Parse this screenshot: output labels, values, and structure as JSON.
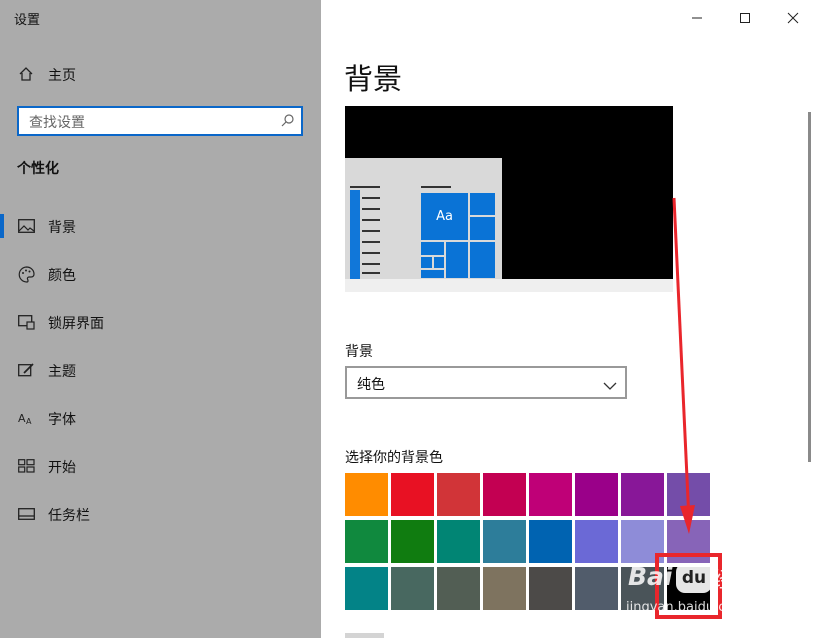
{
  "window": {
    "title": "设置"
  },
  "sidebar": {
    "home_label": "主页",
    "search_placeholder": "查找设置",
    "section_title": "个性化",
    "items": [
      {
        "label": "背景",
        "icon": "picture-icon",
        "selected": true
      },
      {
        "label": "颜色",
        "icon": "palette-icon"
      },
      {
        "label": "锁屏界面",
        "icon": "lock-screen-icon"
      },
      {
        "label": "主题",
        "icon": "theme-icon"
      },
      {
        "label": "字体",
        "icon": "font-icon"
      },
      {
        "label": "开始",
        "icon": "start-icon"
      },
      {
        "label": "任务栏",
        "icon": "taskbar-icon"
      }
    ]
  },
  "main": {
    "title": "背景",
    "preview": {
      "tile_text": "Aa"
    },
    "background_label": "背景",
    "background_value": "纯色",
    "color_label": "选择你的背景色",
    "colors": [
      [
        "#ff8c00",
        "#e81123",
        "#d13438",
        "#c30052",
        "#bf0077",
        "#9a0089",
        "#881798",
        "#744da9"
      ],
      [
        "#10893e",
        "#107c10",
        "#018574",
        "#2d7d9a",
        "#0063b1",
        "#6b69d6",
        "#8e8cd8",
        "#8764b8"
      ],
      [
        "#038387",
        "#486860",
        "#525e54",
        "#7e735f",
        "#4c4a48",
        "#515c6b",
        "#4a5459",
        "#000000"
      ]
    ],
    "selected_color": "#000000"
  },
  "watermark": {
    "logo": "du",
    "brand_a": "Bai",
    "brand_b": "经验",
    "url": "jingyan.baidu.com"
  },
  "colors": {
    "accent": "#0a67c9",
    "sidebar_bg": "#ababab",
    "annotation_red": "#e9262c"
  }
}
